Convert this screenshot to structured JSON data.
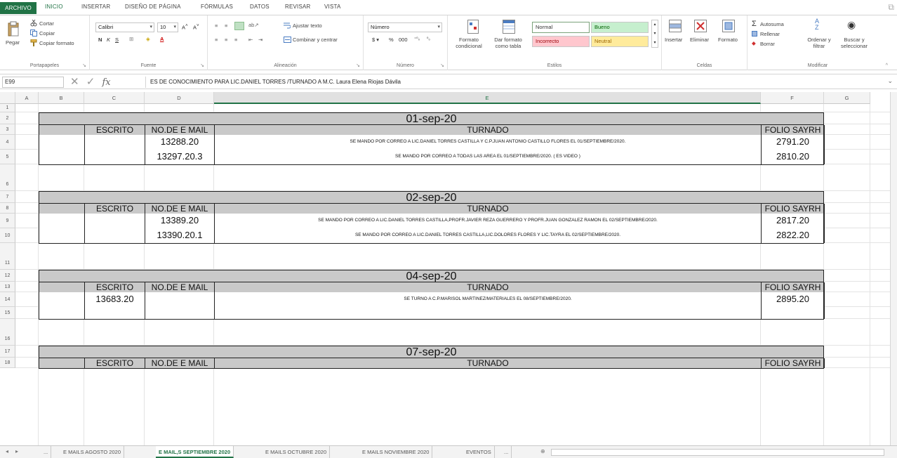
{
  "ribbon_tabs": [
    "ARCHIVO",
    "INICIO",
    "INSERTAR",
    "DISEÑO DE PÁGINA",
    "FÓRMULAS",
    "DATOS",
    "REVISAR",
    "VISTA"
  ],
  "clipboard": {
    "paste": "Pegar",
    "cut": "Cortar",
    "copy": "Copiar",
    "format_painter": "Copiar formato",
    "label": "Portapapeles"
  },
  "font": {
    "name": "Calibri",
    "size": "10",
    "label": "Fuente"
  },
  "alignment": {
    "wrap": "Ajustar texto",
    "merge": "Combinar y centrar",
    "label": "Alineación"
  },
  "number": {
    "format": "Número",
    "label": "Número"
  },
  "styles": {
    "cond_format": "Formato condicional",
    "table_format": "Dar formato como tabla",
    "normal": "Normal",
    "bueno": "Bueno",
    "incorrecto": "Incorrecto",
    "neutral": "Neutral",
    "label": "Estilos"
  },
  "cells": {
    "insert": "Insertar",
    "delete": "Eliminar",
    "format": "Formato",
    "label": "Celdas"
  },
  "editing": {
    "autosum": "Autosuma",
    "fill": "Rellenar",
    "clear": "Borrar",
    "sort": "Ordenar y filtrar",
    "find": "Buscar y seleccionar",
    "label": "Modificar"
  },
  "formula_bar": {
    "name_box": "E99",
    "fx": "fx",
    "value": "ES DE CONOCIMIENTO PARA LIC.DANIEL TORRES /TURNADO A M.C. Laura Elena Riojas Dávila"
  },
  "columns": [
    "A",
    "B",
    "C",
    "D",
    "E",
    "F",
    "G"
  ],
  "rows": [
    "1",
    "2",
    "3",
    "4",
    "5",
    "6",
    "7",
    "8",
    "9",
    "10",
    "11",
    "12",
    "13",
    "14",
    "15",
    "16",
    "17",
    "18"
  ],
  "headers": {
    "escrito": "ESCRITO",
    "mail": "NO.DE E MAIL",
    "turnado": "TURNADO",
    "folio": "FOLIO SAYRH"
  },
  "blocks": [
    {
      "date": "01-sep-20",
      "rows": [
        {
          "escrito": "",
          "mail": "13288.20",
          "turnado": "SE MANDO POR CORREO A LIC.DANIEL TORRES CASTILLA Y C.P.JUAN ANTONIO CASTILLO FLORES EL 01/SEPTIEMBRE/2020.",
          "folio": "2791.20"
        },
        {
          "escrito": "",
          "mail": "13297.20.3",
          "turnado": "SE MANDO POR CORREO A TODAS LAS AREA EL 01/SEPTIEMBRE/2020. ( ES VIDEO )",
          "folio": "2810.20"
        }
      ]
    },
    {
      "date": "02-sep-20",
      "rows": [
        {
          "escrito": "",
          "mail": "13389.20",
          "turnado": "SE MANDO POR CORREO A LIC.DANIEL TORRES CASTILLA,PROFR.JAVIER REZA GUERRERO Y PROFR.JUAN GONZALEZ RAMON EL 02/SEPTIEMBRE/2020.",
          "folio": "2817.20"
        },
        {
          "escrito": "",
          "mail": "13390.20.1",
          "turnado": "SE MANDO POR CORREO A LIC.DANIEL TORRES CASTILLA,LIC.DOLORES FLORES Y LIC.TAYRA EL 02/SEPTIEMBRE/2020.",
          "folio": "2822.20"
        }
      ]
    },
    {
      "date": "04-sep-20",
      "rows": [
        {
          "escrito": "13683.20",
          "mail": "",
          "turnado": "SE TURNO A C.P.MARISOL MARTINEZ/MATERIALES EL 08/SEPTIEMBRE/2020.",
          "folio": "2895.20"
        },
        {
          "escrito": "",
          "mail": "",
          "turnado": "",
          "folio": ""
        }
      ]
    },
    {
      "date": "07-sep-20",
      "rows": []
    }
  ],
  "sheet_tabs": [
    "...",
    "E MAILS AGOSTO 2020",
    "E MAIL,S SEPTIEMBRE 2020",
    "E MAILS OCTUBRE 2020",
    "E MAILS NOVIEMBRE 2020",
    "EVENTOS",
    "..."
  ],
  "active_sheet_index": 2
}
